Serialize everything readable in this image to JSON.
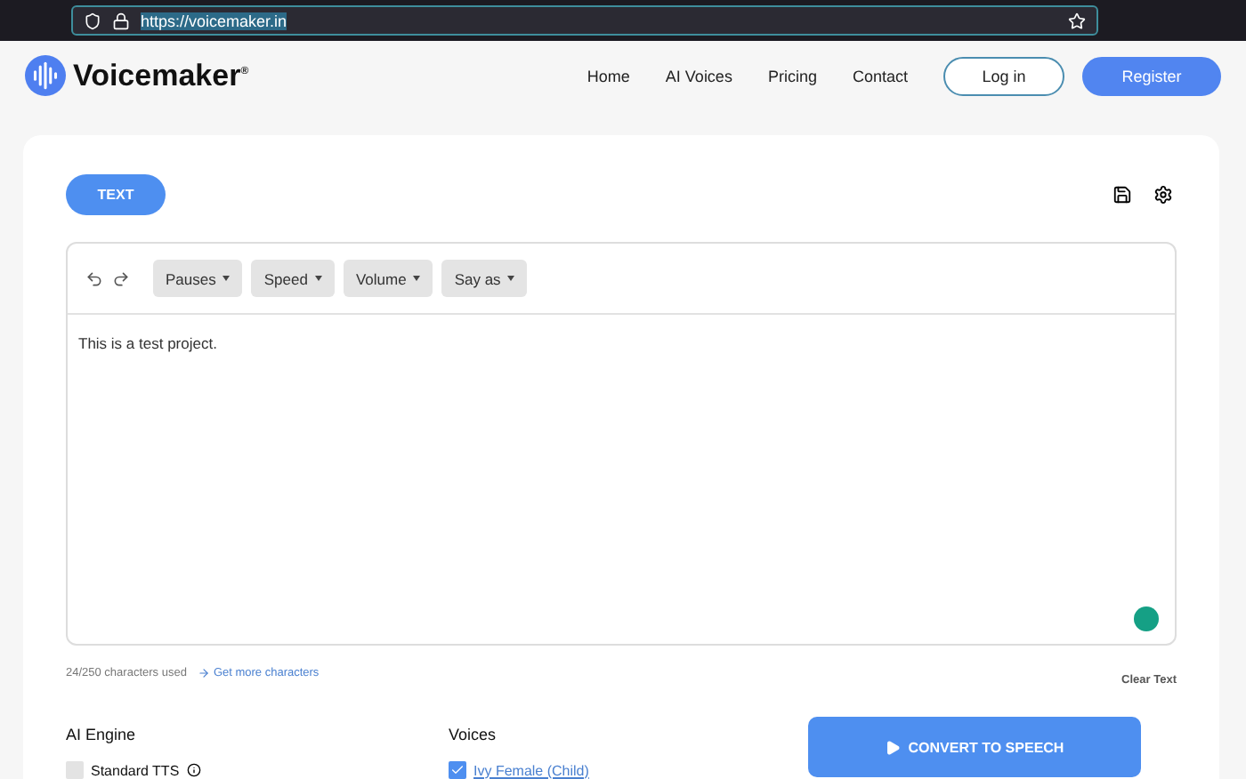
{
  "browser": {
    "url": "https://voicemaker.in"
  },
  "header": {
    "brand": "Voicemaker",
    "brand_mark": "®",
    "nav": [
      "Home",
      "AI Voices",
      "Pricing",
      "Contact"
    ],
    "login": "Log in",
    "register": "Register"
  },
  "mode_tab": {
    "label": "TEXT",
    "selected": true
  },
  "toolbar": {
    "dropdowns": [
      "Pauses",
      "Speed",
      "Volume",
      "Say as"
    ]
  },
  "editor": {
    "value": "This is a test project."
  },
  "counter": {
    "used": "24/250 characters used",
    "link": "Get more characters",
    "clear": "Clear Text"
  },
  "engine": {
    "title": "AI Engine",
    "options": [
      {
        "label": "Standard TTS",
        "checked": false
      }
    ]
  },
  "voices": {
    "title": "Voices",
    "options": [
      {
        "label": "Ivy Female (Child)",
        "checked": true
      }
    ]
  },
  "convert": {
    "label": "CONVERT TO SPEECH"
  }
}
